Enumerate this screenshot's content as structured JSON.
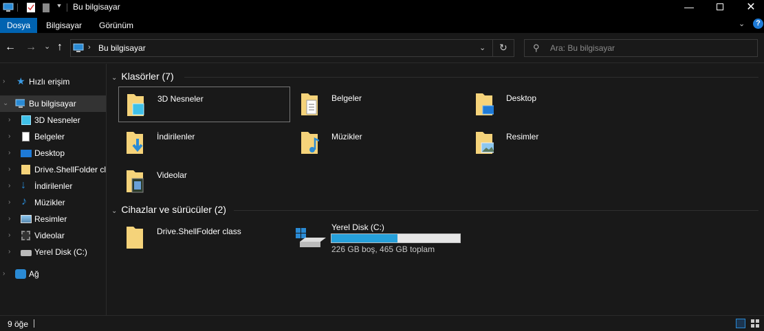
{
  "window": {
    "title": "Bu bilgisayar"
  },
  "ribbon": {
    "tabs": [
      "Dosya",
      "Bilgisayar",
      "Görünüm"
    ],
    "active": "Dosya"
  },
  "nav": {
    "address": "Bu bilgisayar",
    "search_placeholder": "Ara: Bu bilgisayar"
  },
  "sidebar": {
    "quick_access": "Hızlı erişim",
    "this_pc": "Bu bilgisayar",
    "items": [
      "3D Nesneler",
      "Belgeler",
      "Desktop",
      "Drive.ShellFolder class",
      "İndirilenler",
      "Müzikler",
      "Resimler",
      "Videolar",
      "Yerel Disk (C:)"
    ],
    "network": "Ağ"
  },
  "main": {
    "folders_group": "Klasörler (7)",
    "folders": [
      "3D Nesneler",
      "Belgeler",
      "Desktop",
      "İndirilenler",
      "Müzikler",
      "Resimler",
      "Videolar"
    ],
    "drives_group": "Cihazlar ve sürücüler (2)",
    "drive_shell": "Drive.ShellFolder class",
    "disk": {
      "name": "Yerel Disk (C:)",
      "info": "226 GB boş, 465 GB toplam",
      "used_fraction": 0.514
    }
  },
  "status": {
    "count": "9 öğe"
  },
  "colors": {
    "accent": "#0063b1",
    "bar_fill": "#26a0da",
    "folder": "#f5d37a"
  }
}
